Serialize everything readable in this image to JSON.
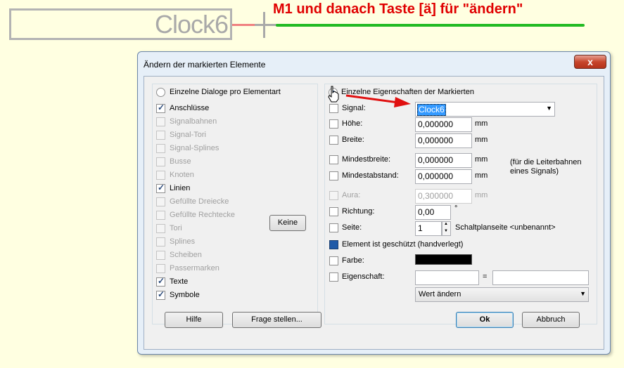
{
  "canvas": {
    "component_label": "Clock6",
    "annotation": "M1 und danach Taste [ä]  für \"ändern\""
  },
  "dialog": {
    "title": "Ändern der markierten Elemente",
    "close_label": "x",
    "mode_left": "Einzelne Dialoge pro Elementart",
    "mode_right": "Einzelne Eigenschaften der Markierten",
    "element_types": [
      {
        "label": "Anschlüsse",
        "checked": true,
        "enabled": true
      },
      {
        "label": "Signalbahnen",
        "checked": false,
        "enabled": false
      },
      {
        "label": "Signal-Tori",
        "checked": false,
        "enabled": false
      },
      {
        "label": "Signal-Splines",
        "checked": false,
        "enabled": false
      },
      {
        "label": "Busse",
        "checked": false,
        "enabled": false
      },
      {
        "label": "Knoten",
        "checked": false,
        "enabled": false
      },
      {
        "label": "Linien",
        "checked": true,
        "enabled": true
      },
      {
        "label": "Gefüllte Dreiecke",
        "checked": false,
        "enabled": false
      },
      {
        "label": "Gefüllte Rechtecke",
        "checked": false,
        "enabled": false
      },
      {
        "label": "Tori",
        "checked": false,
        "enabled": false
      },
      {
        "label": "Splines",
        "checked": false,
        "enabled": false
      },
      {
        "label": "Scheiben",
        "checked": false,
        "enabled": false
      },
      {
        "label": "Passermarken",
        "checked": false,
        "enabled": false
      },
      {
        "label": "Texte",
        "checked": true,
        "enabled": true
      },
      {
        "label": "Symbole",
        "checked": true,
        "enabled": true
      }
    ],
    "keine_label": "Keine",
    "props": {
      "signal_label": "Signal:",
      "signal_value": "Clock6",
      "hoehe_label": "Höhe:",
      "hoehe_value": "0,000000",
      "breite_label": "Breite:",
      "breite_value": "0,000000",
      "mindestbreite_label": "Mindestbreite:",
      "mindestbreite_value": "0,000000",
      "mindestabstand_label": "Mindestabstand:",
      "mindestabstand_value": "0,000000",
      "aura_label": "Aura:",
      "aura_value": "0,300000",
      "unit": "mm",
      "hint_line1": "(für die Leiterbahnen",
      "hint_line2": "eines Signals)",
      "richtung_label": "Richtung:",
      "richtung_value": "0,00",
      "degree": "°",
      "seite_label": "Seite:",
      "seite_value": "1",
      "seite_hint": "Schaltplanseite <unbenannt>",
      "geschuetzt_label": "Element ist geschützt (handverlegt)",
      "farbe_label": "Farbe:",
      "farbe_color": "#000000",
      "eigenschaft_label": "Eigenschaft:",
      "eigenschaft_name": "",
      "equals": "=",
      "eigenschaft_value": "",
      "wert_aendern": "Wert ändern"
    },
    "buttons": {
      "hilfe": "Hilfe",
      "frage": "Frage stellen...",
      "ok": "Ok",
      "abbruch": "Abbruch"
    }
  }
}
